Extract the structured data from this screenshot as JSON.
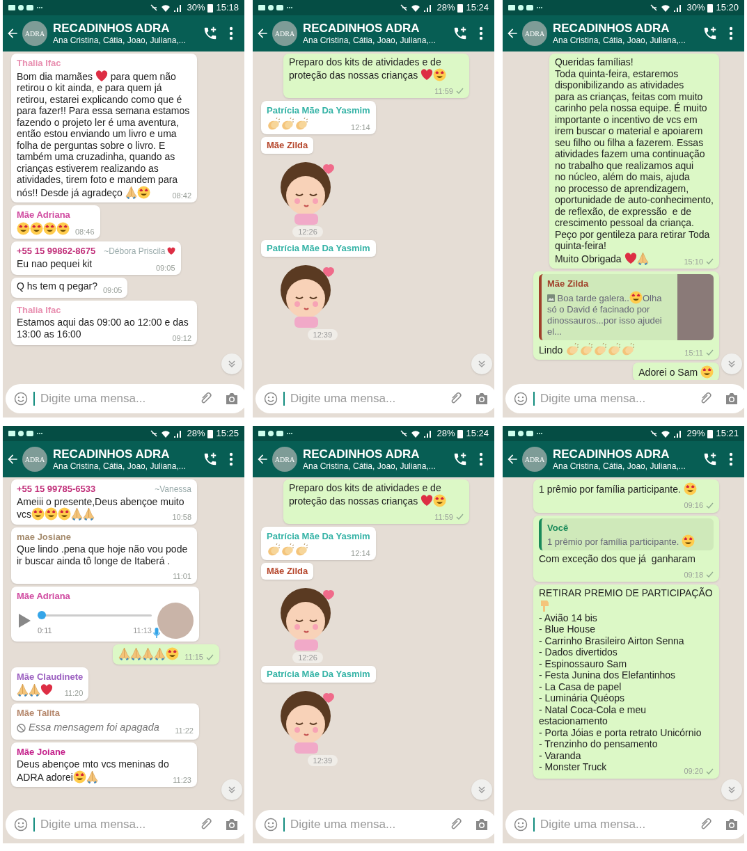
{
  "panels": [
    {
      "status_bar": {
        "battery": "30%",
        "time": "15:18"
      },
      "header": {
        "logo_text": "ADRA",
        "title": "RECADINHOS ADRA",
        "subtitle": "Ana Cristina, Cátia, Joao, Juliana,..."
      },
      "scroll_button": true,
      "composer": {
        "placeholder": "Digite uma mensa..."
      },
      "messages": [
        {
          "kind": "text",
          "outgoing": false,
          "sender": "Thalia Ifac",
          "color": "#e88fb0",
          "parts": [
            {
              "kind": "text",
              "text": "Bom dia mamães "
            },
            {
              "kind": "heart"
            },
            {
              "kind": "text",
              "text": " para quem não retirou o kit ainda, e para quem já retirou, estarei explicando como que é para fazer!! Para essa semana estamos fazendo o projeto ler é uma aventura, então estou enviando um livro e uma folha de perguntas sobre o livro. E também uma cruzadinha, quando as crianças estiverem realizando as atividades, tirem foto e mandem para nós!! Desde já agradeço "
            },
            {
              "kind": "pray"
            },
            {
              "kind": "face"
            }
          ],
          "time": "08:42"
        },
        {
          "kind": "text",
          "outgoing": false,
          "sender": "Mãe Adriana",
          "color": "#d04aa0",
          "parts": [
            {
              "kind": "face"
            },
            {
              "kind": "face"
            },
            {
              "kind": "face"
            },
            {
              "kind": "face"
            }
          ],
          "time": "08:46"
        },
        {
          "kind": "text",
          "outgoing": false,
          "sender": "+55 15 99862-8675",
          "color": "#c1307a",
          "sender_note": "~Débora Priscila",
          "sender_note_heart": true,
          "parts": [
            {
              "kind": "text",
              "text": "Eu nao pequei kit"
            }
          ],
          "time": "09:05"
        },
        {
          "kind": "text",
          "outgoing": false,
          "parts": [
            {
              "kind": "text",
              "text": "Q hs tem q pegar?"
            }
          ],
          "time": "09:05"
        },
        {
          "kind": "text",
          "outgoing": false,
          "sender": "Thalia Ifac",
          "color": "#e88fb0",
          "parts": [
            {
              "kind": "text",
              "text": "Estamos aqui das 09:00 ao 12:00 e das 13:00 as 16:00"
            }
          ],
          "time": "09:12"
        }
      ]
    },
    {
      "status_bar": {
        "battery": "28%",
        "time": "15:24"
      },
      "header": {
        "logo_text": "ADRA",
        "title": "RECADINHOS ADRA",
        "subtitle": "Ana Cristina, Cátia, Joao, Juliana,..."
      },
      "scroll_button": true,
      "composer": {
        "placeholder": "Digite uma mensa..."
      },
      "messages": [
        {
          "kind": "text",
          "outgoing": true,
          "parts": [
            {
              "kind": "text",
              "text": "Preparo dos kits de atividades e de proteção das nossas crianças "
            },
            {
              "kind": "heart"
            },
            {
              "kind": "face"
            }
          ],
          "time": "11:59"
        },
        {
          "kind": "text",
          "outgoing": false,
          "sender": "Patrícia Mãe Da Yasmim",
          "color": "#35b3a6",
          "parts": [
            {
              "kind": "clap"
            },
            {
              "kind": "clap"
            },
            {
              "kind": "clap"
            }
          ],
          "time": "12:14"
        },
        {
          "kind": "sticker",
          "sender": "Mãe Zilda",
          "color": "#b5452a",
          "time": "12:26"
        },
        {
          "kind": "sticker",
          "sender": "Patrícia Mãe Da Yasmim",
          "color": "#35b3a6",
          "time": "12:39"
        }
      ]
    },
    {
      "status_bar": {
        "battery": "30%",
        "time": "15:20"
      },
      "header": {
        "logo_text": "ADRA",
        "title": "RECADINHOS ADRA",
        "subtitle": "Ana Cristina, Cátia, Joao, Juliana,..."
      },
      "scroll_button": true,
      "composer": {
        "placeholder": "Digite uma mensa..."
      },
      "messages": [
        {
          "kind": "text",
          "outgoing": true,
          "parts": [
            {
              "kind": "text",
              "text": "Queridas famílias!\nToda quinta-feira, estaremos\ndisponibilizando as atividades\npara as crianças, feitas com muito\ncarinho pela nossa equipe. É muito\nimportante o incentivo de vcs em\nirem buscar o material e apoiarem\nseu filho ou filha a fazerem. Essas\natividades fazem uma continuação\nno trabalho que realizamos aqui\nno núcleo, além do mais, ajuda\nno processo de aprendizagem,\noportunidade de auto-conhecimento,\nde reflexão, de expressão  e de\ncrescimento pessoal da criança.\nPeço por gentileza para retirar Toda\nquinta-feira!\nMuito Obrigada "
            },
            {
              "kind": "heart"
            },
            {
              "kind": "pray"
            }
          ],
          "time": "15:10"
        },
        {
          "kind": "reply",
          "outgoing": true,
          "quote": {
            "sender": "Mãe Zilda",
            "color": "#a0402a",
            "parts": [
              {
                "kind": "image"
              },
              {
                "kind": "text",
                "text": " Boa tarde galera.."
              },
              {
                "kind": "face"
              },
              {
                "kind": "text",
                "text": "Olha só o David é facinado por dinossauros...por isso ajudei el..."
              }
            ],
            "thumbnail": true
          },
          "parts": [
            {
              "kind": "text",
              "text": "Lindo "
            },
            {
              "kind": "clap"
            },
            {
              "kind": "clap"
            },
            {
              "kind": "clap"
            },
            {
              "kind": "clap"
            },
            {
              "kind": "clap"
            }
          ],
          "time": "15:11"
        },
        {
          "kind": "text",
          "outgoing": true,
          "parts": [
            {
              "kind": "text",
              "text": "Adorei o Sam "
            },
            {
              "kind": "face"
            }
          ]
        }
      ]
    },
    {
      "status_bar": {
        "battery": "28%",
        "time": "15:25"
      },
      "header": {
        "logo_text": "ADRA",
        "title": "RECADINHOS ADRA",
        "subtitle": "Ana Cristina, Cátia, Joao, Juliana,..."
      },
      "scroll_button": true,
      "composer": {
        "placeholder": "Digite uma mensa..."
      },
      "messages": [
        {
          "kind": "text",
          "outgoing": false,
          "sender": "+55 15 99785-6533",
          "color": "#c1307a",
          "sender_note": "~Vanessa",
          "parts": [
            {
              "kind": "text",
              "text": "Ameiii o presente,Deus abençoe muito vcs"
            },
            {
              "kind": "face"
            },
            {
              "kind": "face"
            },
            {
              "kind": "face"
            },
            {
              "kind": "pray"
            },
            {
              "kind": "pray"
            }
          ],
          "time": "10:58"
        },
        {
          "kind": "text",
          "outgoing": false,
          "sender": "mae Josiane",
          "color": "#a58b6d",
          "parts": [
            {
              "kind": "text",
              "text": "Que lindo .pena que hoje não vou pode ir buscar ainda tô longe de Itaberá ."
            }
          ],
          "time": "11:01"
        },
        {
          "kind": "voice",
          "sender": "Mãe Adriana",
          "color": "#d04aa0",
          "level": 0,
          "duration": "0:11",
          "time": "11:13"
        },
        {
          "kind": "text",
          "outgoing": true,
          "parts": [
            {
              "kind": "pray"
            },
            {
              "kind": "pray"
            },
            {
              "kind": "pray"
            },
            {
              "kind": "pray"
            },
            {
              "kind": "face"
            }
          ],
          "time": "11:15"
        },
        {
          "kind": "text",
          "outgoing": false,
          "sender": "Mãe Claudinete",
          "color": "#9b5fc0",
          "parts": [
            {
              "kind": "pray"
            },
            {
              "kind": "pray"
            },
            {
              "kind": "heart"
            }
          ],
          "time": "11:20"
        },
        {
          "kind": "deleted",
          "sender": "Mãe Talita",
          "color": "#b5876b",
          "text": "Essa mensagem foi apagada",
          "time": "11:22"
        },
        {
          "kind": "text",
          "outgoing": false,
          "sender": "Mãe Joiane",
          "color": "#c4208a",
          "parts": [
            {
              "kind": "text",
              "text": "Deus abençoe mto vcs meninas do ADRA adorei"
            },
            {
              "kind": "face"
            },
            {
              "kind": "pray"
            }
          ],
          "time": "11:23"
        }
      ]
    },
    {
      "status_bar": {
        "battery": "28%",
        "time": "15:24"
      },
      "header": {
        "logo_text": "ADRA",
        "title": "RECADINHOS ADRA",
        "subtitle": "Ana Cristina, Cátia, Joao, Juliana,..."
      },
      "scroll_button": true,
      "composer": {
        "placeholder": "Digite uma mensa..."
      },
      "messages": [
        {
          "kind": "text",
          "outgoing": true,
          "parts": [
            {
              "kind": "text",
              "text": "Preparo dos kits de atividades e de proteção das nossas crianças "
            },
            {
              "kind": "heart"
            },
            {
              "kind": "face"
            }
          ],
          "time": "11:59"
        },
        {
          "kind": "text",
          "outgoing": false,
          "sender": "Patrícia Mãe Da Yasmim",
          "color": "#35b3a6",
          "parts": [
            {
              "kind": "clap"
            },
            {
              "kind": "clap"
            },
            {
              "kind": "clap"
            }
          ],
          "time": "12:14"
        },
        {
          "kind": "sticker",
          "sender": "Mãe Zilda",
          "color": "#b5452a",
          "time": "12:26"
        },
        {
          "kind": "sticker",
          "sender": "Patrícia Mãe Da Yasmim",
          "color": "#35b3a6",
          "time": "12:39"
        }
      ]
    },
    {
      "status_bar": {
        "battery": "29%",
        "time": "15:21"
      },
      "header": {
        "logo_text": "ADRA",
        "title": "RECADINHOS ADRA",
        "subtitle": "Ana Cristina, Cátia, Joao, Juliana,..."
      },
      "scroll_button": true,
      "composer": {
        "placeholder": "Digite uma mensa..."
      },
      "messages": [
        {
          "kind": "text",
          "outgoing": true,
          "parts": [
            {
              "kind": "text",
              "text": "1 prêmio por família participante. "
            },
            {
              "kind": "face"
            }
          ],
          "time": "09:16"
        },
        {
          "kind": "reply",
          "outgoing": true,
          "quote": {
            "sender": "Você",
            "color": "#1a8a5a",
            "parts": [
              {
                "kind": "text",
                "text": "1 prêmio por família participante. "
              },
              {
                "kind": "face"
              }
            ],
            "thumbnail": false
          },
          "parts": [
            {
              "kind": "text",
              "text": "Com exceção dos que já  ganharam"
            }
          ],
          "time": "09:18"
        },
        {
          "kind": "text",
          "outgoing": true,
          "parts": [
            {
              "kind": "text",
              "text": "RETIRAR PREMIO DE PARTICIPAÇÃO\n"
            },
            {
              "kind": "point"
            },
            {
              "kind": "text",
              "text": "\n- Avião 14 bis\n- Blue House\n- Carrinho Brasileiro Airton Senna\n- Dados divertidos\n- Espinossauro Sam\n- Festa Junina dos Elefantinhos\n- La Casa de papel\n- Luminária Quéops\n- Natal Coca-Cola e meu estacionamento\n- Porta Jóias e porta retrato Unicórnio\n- Trenzinho do pensamento\n- Varanda\n- Monster Truck"
            }
          ],
          "time": "09:20"
        }
      ]
    }
  ]
}
